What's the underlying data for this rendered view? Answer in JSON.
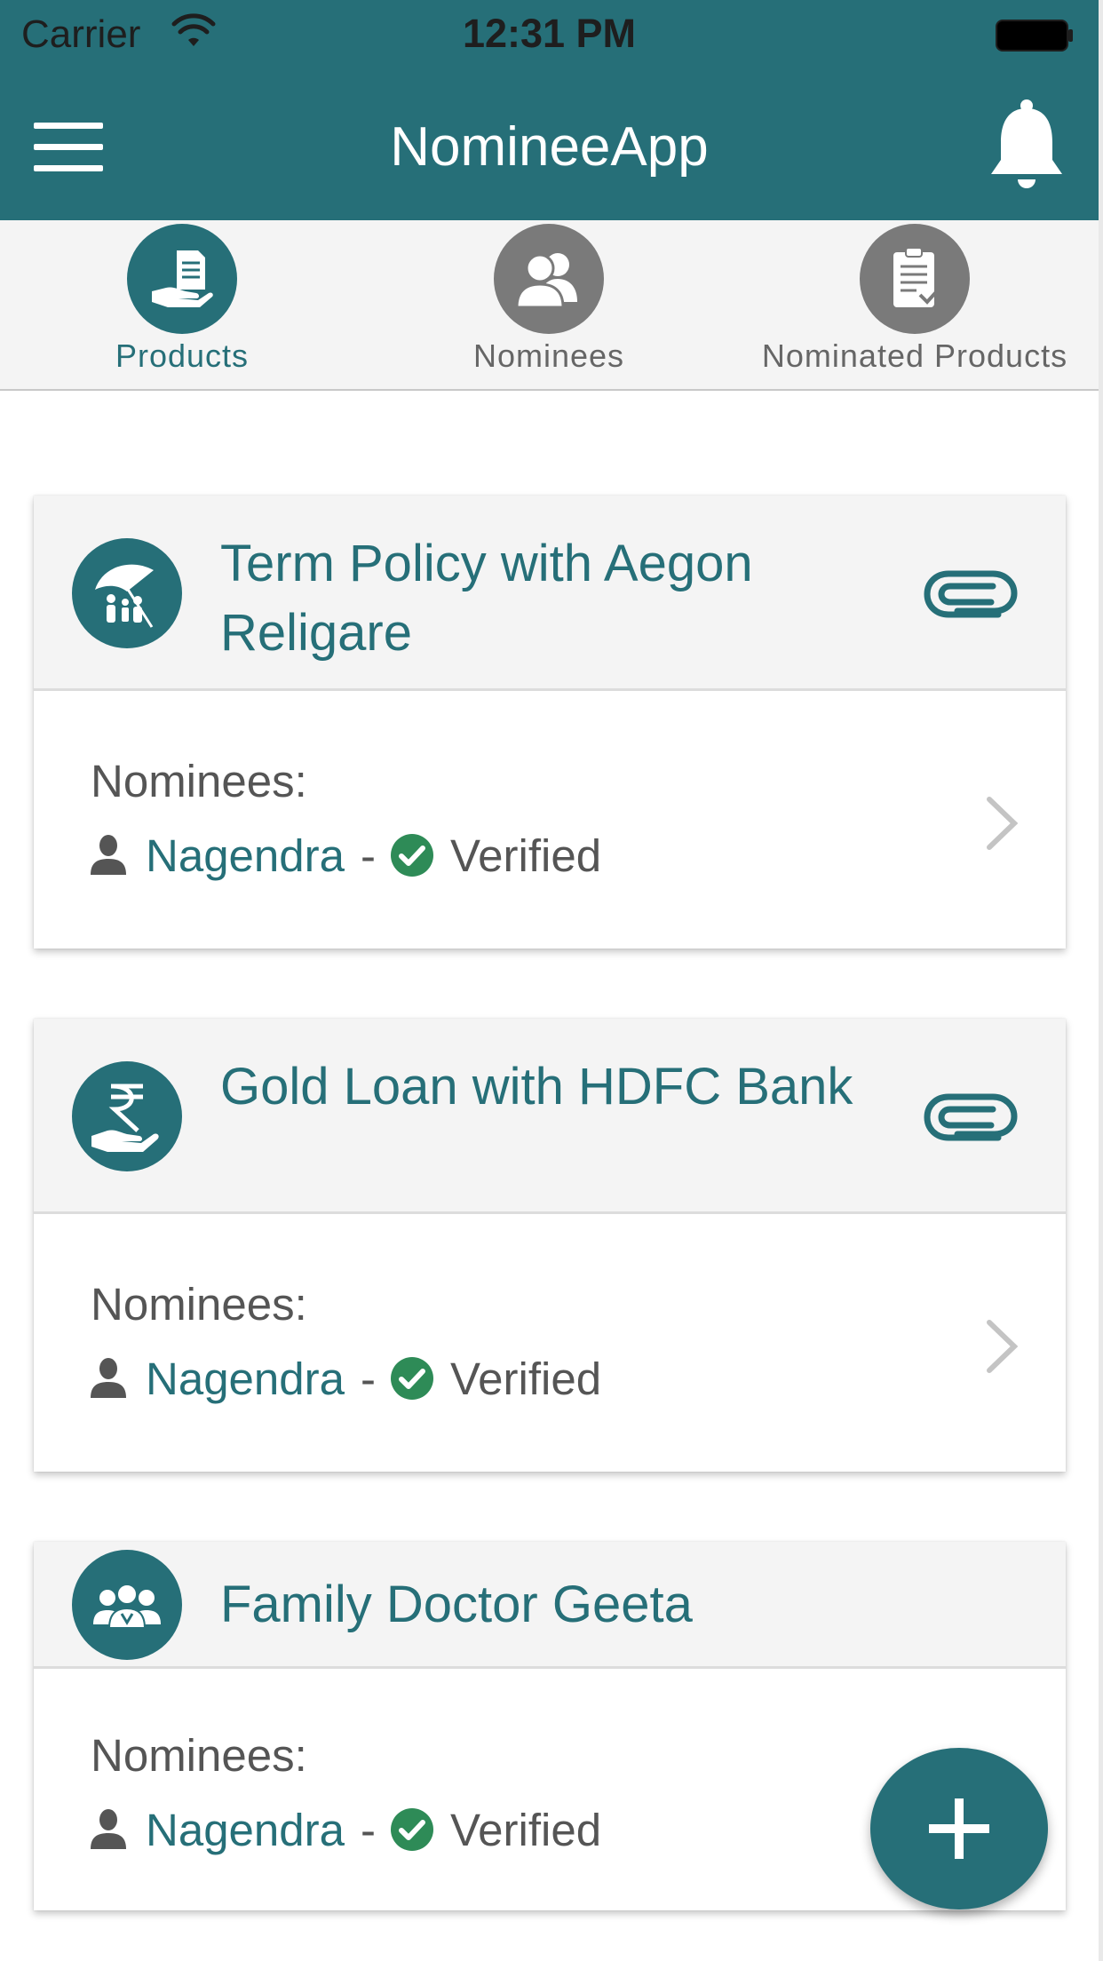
{
  "status_bar": {
    "carrier": "Carrier",
    "time": "12:31 PM",
    "wifi_icon": "wifi-icon",
    "battery_icon": "battery-icon"
  },
  "nav": {
    "title": "NomineeApp",
    "menu_icon": "hamburger-menu-icon",
    "bell_icon": "bell-icon"
  },
  "tabs": [
    {
      "label": "Products",
      "icon": "hand-document-icon",
      "active": true
    },
    {
      "label": "Nominees",
      "icon": "people-icon",
      "active": false
    },
    {
      "label": "Nominated Products",
      "icon": "clipboard-check-icon",
      "active": false
    }
  ],
  "cards": [
    {
      "title": "Term Policy with Aegon Religare",
      "icon": "umbrella-family-icon",
      "nominees_label": "Nominees:",
      "nominee": "Nagendra",
      "separator": "-",
      "status": "Verified"
    },
    {
      "title": "Gold Loan with HDFC Bank",
      "icon": "rupee-hand-icon",
      "nominees_label": "Nominees:",
      "nominee": "Nagendra",
      "separator": "-",
      "status": "Verified"
    },
    {
      "title": "Family Doctor Geeta",
      "icon": "doctor-group-icon",
      "nominees_label": "Nominees:",
      "nominee": "Nagendra",
      "separator": "-",
      "status": "Verified"
    }
  ],
  "fab": {
    "icon": "plus-icon"
  },
  "colors": {
    "primary": "#266f78",
    "inactive_tab": "#7a7a7a",
    "verified_green": "#2e8b57",
    "text_gray": "#555555",
    "header_gray": "#f4f4f4"
  }
}
